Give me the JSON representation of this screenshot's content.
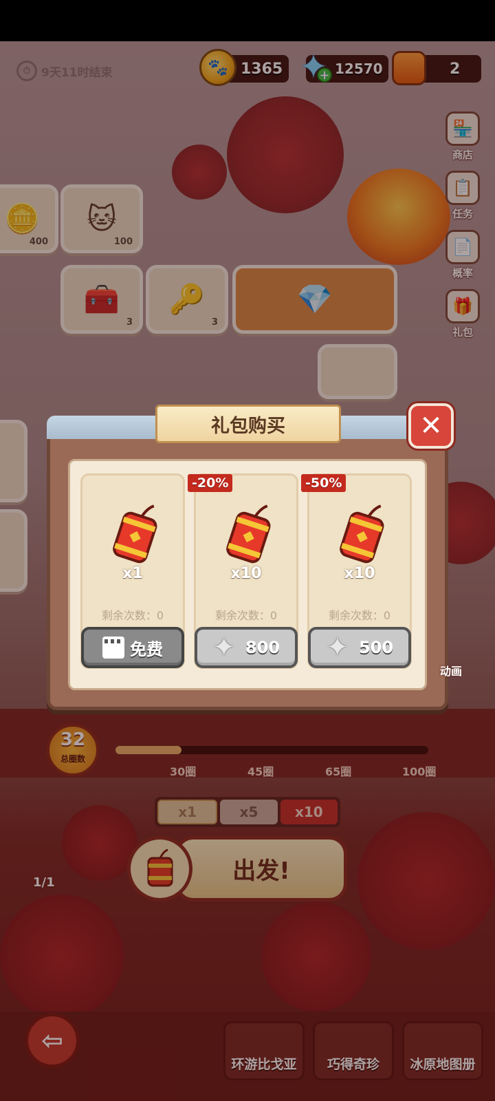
{
  "event": {
    "timer_text": "9天11时结束"
  },
  "resources": {
    "coins": "1365",
    "stars": "12570",
    "jars": "2"
  },
  "side_menu": [
    {
      "label": "商店",
      "icon": "shop-icon"
    },
    {
      "label": "任务",
      "icon": "task-icon"
    },
    {
      "label": "概率",
      "icon": "probability-icon"
    },
    {
      "label": "礼包",
      "icon": "gift-pack-icon"
    }
  ],
  "board_tiles": [
    {
      "count": "400",
      "icon": "coin-tile-icon"
    },
    {
      "count": "100",
      "icon": "cat-tile-icon"
    },
    {
      "count": "3",
      "icon": "chest-tile-icon"
    },
    {
      "count": "3",
      "icon": "key-tile-icon"
    }
  ],
  "modal": {
    "title": "礼包购买",
    "cards": [
      {
        "qty": "x1",
        "remaining": "剩余次数：0",
        "button_label": "免费",
        "button_kind": "free",
        "discount": ""
      },
      {
        "qty": "x10",
        "remaining": "剩余次数：0",
        "button_label": "800",
        "button_kind": "paid",
        "discount": "-20%"
      },
      {
        "qty": "x10",
        "remaining": "剩余次数：0",
        "button_label": "500",
        "button_kind": "paid",
        "discount": "-50%"
      }
    ]
  },
  "side_extra_label": "动画",
  "laps": {
    "count": "32",
    "label": "总圈数",
    "progress_fraction": 0.21
  },
  "milestones": [
    "30圈",
    "45圈",
    "65圈",
    "100圈"
  ],
  "multipliers": {
    "options": [
      "x1",
      "x5",
      "x10"
    ],
    "selected_index": 2
  },
  "go": {
    "label": "出发!",
    "count": "1/1"
  },
  "bottom_nav": [
    "环游比戈亚",
    "巧得奇珍",
    "冰原地图册"
  ],
  "colors": {
    "accent_red": "#c42a1e",
    "panel_brown": "#9a6a56",
    "cream": "#f4ead7"
  }
}
